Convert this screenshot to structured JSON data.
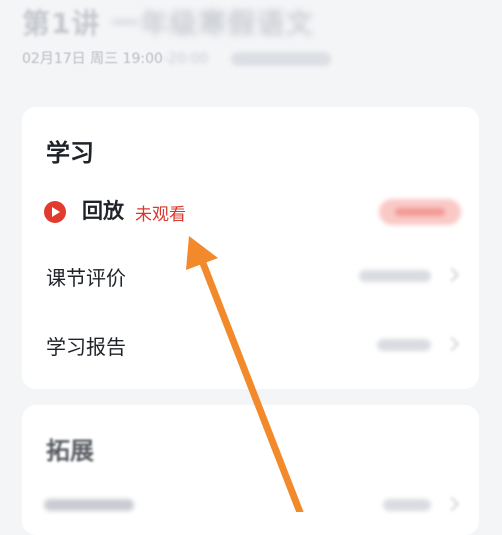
{
  "header": {
    "lesson_number": "第1讲",
    "lesson_title_obscured": "一年级寒假语文",
    "date": "02月17日 周三",
    "time_start": "19:00",
    "time_end": "-20:00"
  },
  "study": {
    "title": "学习",
    "replay": {
      "label": "回放",
      "status": "未观看"
    },
    "items": [
      {
        "label": "课节评价"
      },
      {
        "label": "学习报告"
      }
    ]
  },
  "extension": {
    "title": "拓展"
  },
  "colors": {
    "accent_red": "#d8382c",
    "annotation_arrow": "#f28a2b"
  },
  "icons": {
    "replay": "play-circle-icon",
    "row_chevron": "chevron-right-icon"
  }
}
